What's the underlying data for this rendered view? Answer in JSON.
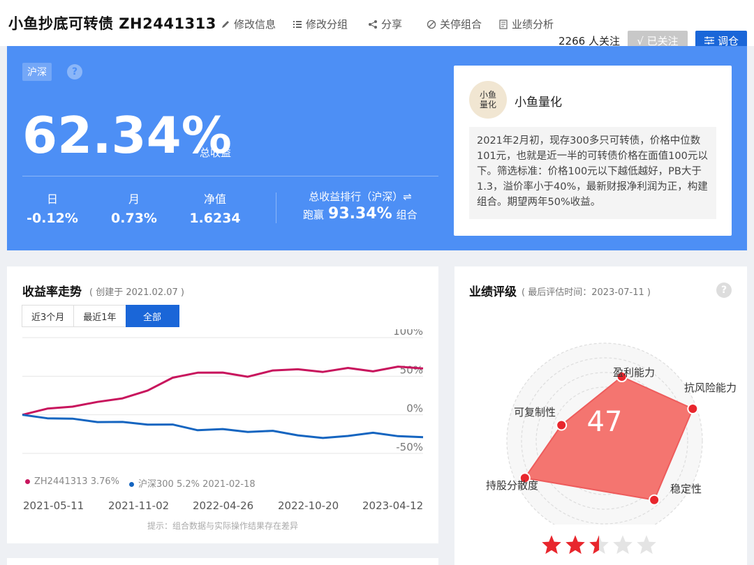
{
  "header": {
    "portfolio_name": "小鱼抄底可转债 ZH2441313",
    "actions": [
      {
        "label": "修改信息",
        "icon": "edit-icon"
      },
      {
        "label": "修改分组",
        "icon": "list-icon"
      },
      {
        "label": "分享",
        "icon": "share-icon"
      },
      {
        "label": "关停组合",
        "icon": "ban-icon"
      },
      {
        "label": "业绩分析",
        "icon": "report-icon"
      }
    ],
    "followers": "2266 人关注",
    "followed_label": "√ 已关注",
    "rebalance_label": "调仓"
  },
  "hero": {
    "market_tag": "沪深",
    "total_return": "62.34%",
    "total_return_label": "总收益",
    "stats": [
      {
        "label": "日",
        "value": "-0.12%"
      },
      {
        "label": "月",
        "value": "0.73%"
      },
      {
        "label": "净值",
        "value": "1.6234"
      }
    ],
    "rank_title": "总收益排行（沪深）⇌",
    "rank_prefix": "跑赢",
    "rank_value": "93.34%",
    "rank_suffix": "组合",
    "author": "小鱼量化",
    "avatar_text": "小鱼量化",
    "description": "2021年2月初，现存300多只可转债，价格中位数101元，也就是近一半的可转债价格在面值100元以下。筛选标准：价格100元以下越低越好，PB大于1.3，溢价率小于40%，最新财报净利润为正，构建组合。期望两年50%收益。"
  },
  "trend": {
    "title": "收益率走势",
    "created": "( 创建于 2021.02.07 )",
    "tabs": [
      "近3个月",
      "最近1年",
      "全部"
    ],
    "active_tab": "全部",
    "legend": [
      {
        "label": "ZH2441313 3.76%",
        "color": "#c8155d"
      },
      {
        "label": "沪深300 5.2% 2021-02-18",
        "color": "#1565c0"
      }
    ],
    "hint": "提示：组合数据与实际操作结果存在差异"
  },
  "chart_data": {
    "type": "line",
    "x_ticks": [
      "2021-05-11",
      "2021-11-02",
      "2022-04-26",
      "2022-10-20",
      "2023-04-12"
    ],
    "y_ticks": [
      "100%",
      "50%",
      "0%",
      "-50%"
    ],
    "ylim": [
      -50,
      100
    ],
    "grid": true,
    "series": [
      {
        "name": "ZH2441313",
        "color": "#c8155d",
        "values": [
          0,
          8,
          12,
          16,
          22,
          30,
          48,
          56,
          54,
          50,
          56,
          59,
          57,
          60,
          57,
          61,
          60
        ]
      },
      {
        "name": "沪深300",
        "color": "#1565c0",
        "values": [
          0,
          -6,
          -5,
          -8,
          -10,
          -12,
          -14,
          -20,
          -17,
          -23,
          -20,
          -28,
          -30,
          -26,
          -24,
          -27,
          -29
        ]
      }
    ]
  },
  "rating": {
    "title": "业绩评级",
    "subtitle": "( 最后评估时间：2023-07-11 )",
    "score": "47",
    "axes": [
      "盈利能力",
      "抗风险能力",
      "稳定性",
      "持股分散度",
      "可复制性"
    ],
    "axis_values": [
      0.68,
      0.96,
      0.79,
      0.9,
      0.47
    ],
    "stars_filled": 2.5,
    "stars_total": 5
  }
}
